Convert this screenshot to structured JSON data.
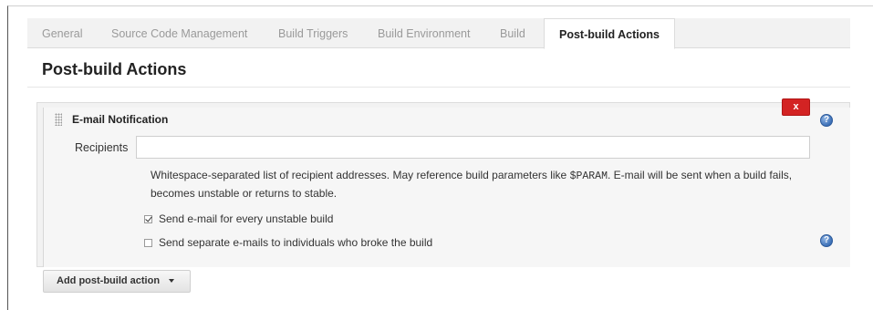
{
  "tabs": [
    {
      "label": "General"
    },
    {
      "label": "Source Code Management"
    },
    {
      "label": "Build Triggers"
    },
    {
      "label": "Build Environment"
    },
    {
      "label": "Build"
    },
    {
      "label": "Post-build Actions"
    }
  ],
  "active_tab": "Post-build Actions",
  "section_title": "Post-build Actions",
  "email_notification": {
    "header": "E-mail Notification",
    "delete_label": "x",
    "help_icon": "question-mark-icon",
    "recipients_label": "Recipients",
    "recipients_value": "",
    "help_text_part1": "Whitespace-separated list of recipient addresses. May reference build parameters like ",
    "help_text_code": "$PARAM",
    "help_text_part2": ". E-mail will be sent when a build fails, becomes unstable or returns to stable.",
    "options": [
      {
        "label": "Send e-mail for every unstable build",
        "checked": true
      },
      {
        "label": "Send separate e-mails to individuals who broke the build",
        "checked": false
      }
    ]
  },
  "add_action_label": "Add post-build action",
  "colors": {
    "delete_red": "#d32323",
    "help_blue": "#3b6fb6",
    "panel_bg": "#f2f2f2"
  }
}
